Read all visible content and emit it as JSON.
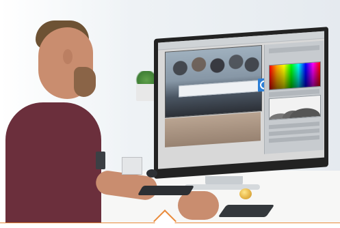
{
  "scene": {
    "accent_color": "#e98a3a",
    "search_button_color": "#2d7fd6"
  },
  "icons": {
    "search": "search-icon"
  }
}
